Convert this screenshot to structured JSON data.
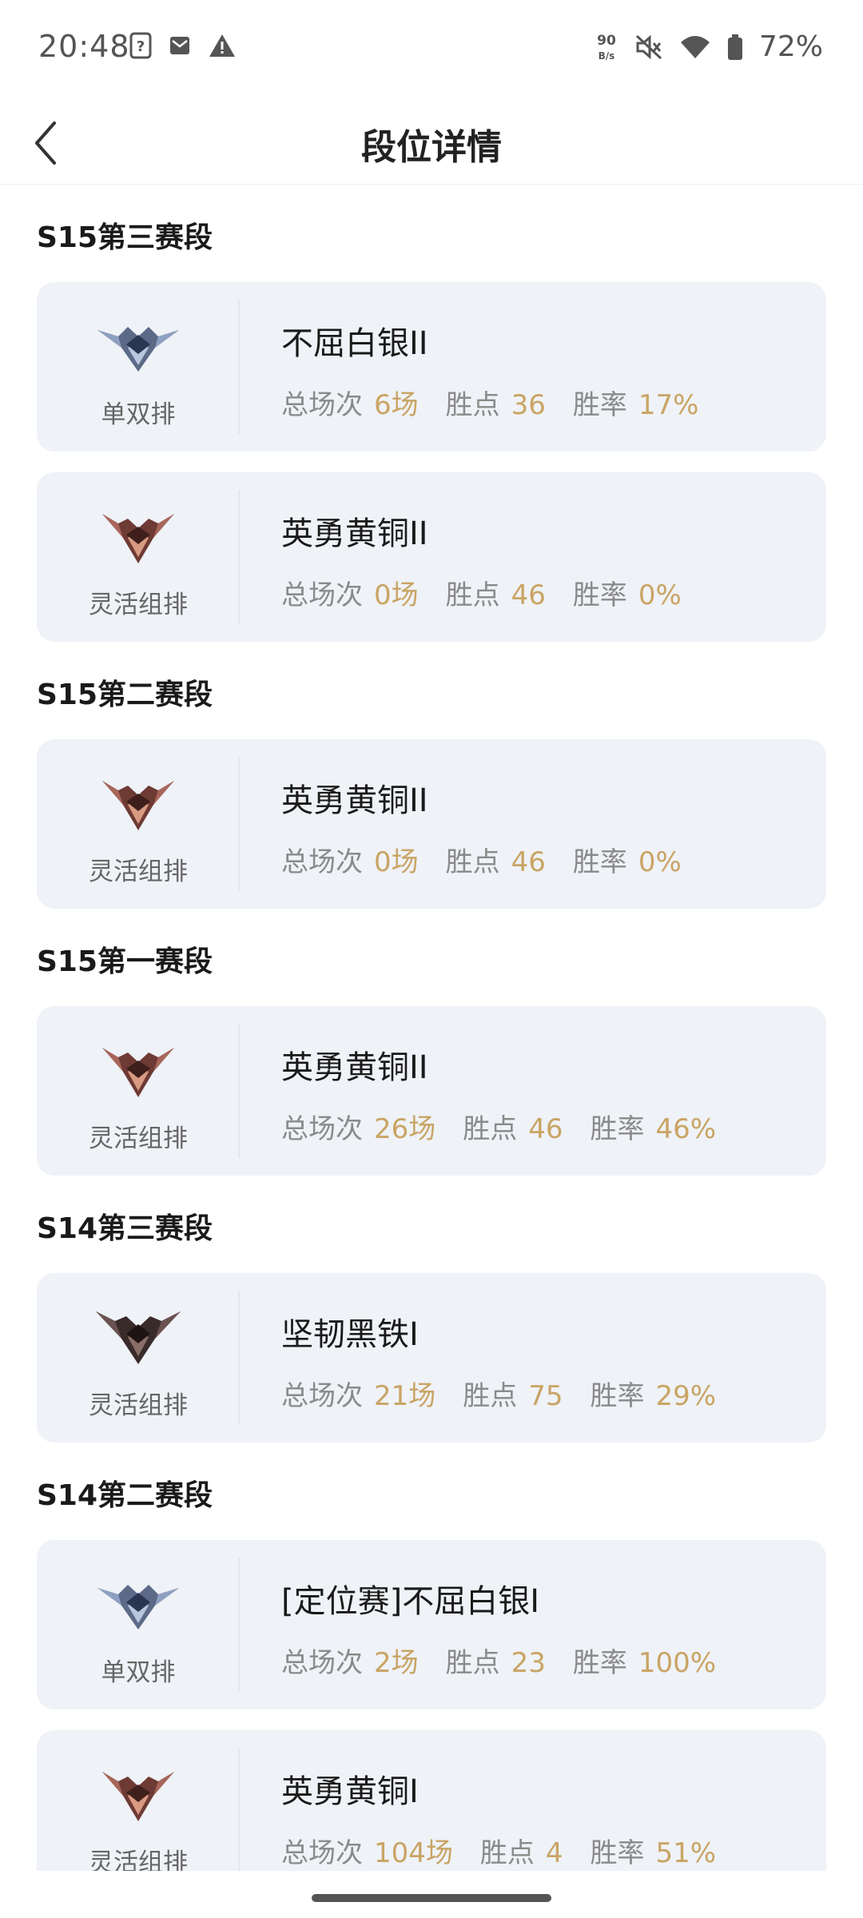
{
  "status_bar": {
    "time": "20:48",
    "battery": "72%",
    "speed_top": "90",
    "speed_unit": "B/s",
    "icons": [
      "sim-question-icon",
      "mail-icon",
      "warning-icon",
      "mute-icon",
      "wifi-icon",
      "battery-icon"
    ]
  },
  "header": {
    "title": "段位详情",
    "back_icon": "chevron-left-icon"
  },
  "labels": {
    "total": "总场次",
    "lp": "胜点",
    "winrate": "胜率"
  },
  "seasons": [
    {
      "title": "S15第三赛段",
      "ranks": [
        {
          "queue": "单双排",
          "rank": "不屈白银II",
          "emblem": "silver-emblem-icon",
          "games": "6场",
          "lp": "36",
          "winrate": "17%"
        },
        {
          "queue": "灵活组排",
          "rank": "英勇黄铜II",
          "emblem": "bronze-emblem-icon",
          "games": "0场",
          "lp": "46",
          "winrate": "0%"
        }
      ]
    },
    {
      "title": "S15第二赛段",
      "ranks": [
        {
          "queue": "灵活组排",
          "rank": "英勇黄铜II",
          "emblem": "bronze-emblem-icon",
          "games": "0场",
          "lp": "46",
          "winrate": "0%"
        }
      ]
    },
    {
      "title": "S15第一赛段",
      "ranks": [
        {
          "queue": "灵活组排",
          "rank": "英勇黄铜II",
          "emblem": "bronze-emblem-icon",
          "games": "26场",
          "lp": "46",
          "winrate": "46%"
        }
      ]
    },
    {
      "title": "S14第三赛段",
      "ranks": [
        {
          "queue": "灵活组排",
          "rank": "坚韧黑铁I",
          "emblem": "iron-emblem-icon",
          "games": "21场",
          "lp": "75",
          "winrate": "29%"
        }
      ]
    },
    {
      "title": "S14第二赛段",
      "ranks": [
        {
          "queue": "单双排",
          "rank": "[定位赛]不屈白银I",
          "emblem": "silver-emblem-icon",
          "games": "2场",
          "lp": "23",
          "winrate": "100%"
        },
        {
          "queue": "灵活组排",
          "rank": "英勇黄铜I",
          "emblem": "bronze-emblem-icon",
          "games": "104场",
          "lp": "4",
          "winrate": "51%"
        }
      ]
    }
  ],
  "colors": {
    "accent": "#c9a464",
    "card_bg": "#eff2f7",
    "label_gray": "#8a8a8a"
  }
}
